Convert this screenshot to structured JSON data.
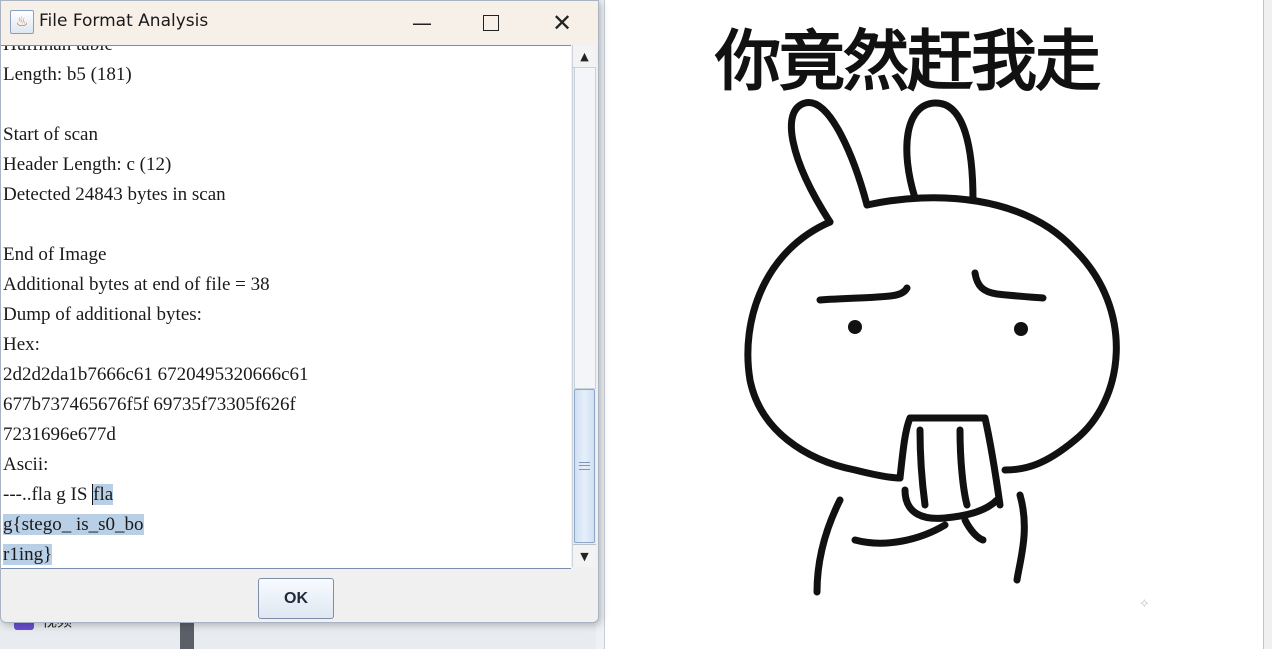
{
  "dialog": {
    "title": "File Format Analysis",
    "ok_label": "OK",
    "lines": [
      "Huffman table",
      "Length: b5 (181)",
      "",
      "Start of scan",
      "Header Length: c (12)",
      "Detected 24843 bytes in scan",
      "",
      "End of Image",
      "Additional bytes at end of file = 38",
      "Dump of additional bytes:",
      "Hex:",
      "2d2d2da1b7666c61 6720495320666c61",
      "677b737465676f5f 69735f73305f626f",
      "7231696e677d",
      "Ascii:"
    ],
    "ascii_line1_pre": "---..fla g IS ",
    "ascii_line1_sel": "fla",
    "ascii_line2_sel": "g{stego_ is_s0_bo",
    "ascii_line3_sel": "r1ing}"
  },
  "taskbar": {
    "item_label": "视频",
    "close_glyph": "✕"
  },
  "meme": {
    "caption": "你竟然赶我走",
    "watermark": "⟡"
  },
  "colors": {
    "selection": "#b8cfe6",
    "titlebar": "#f6f0e9",
    "dialog_bg": "#f0f0f0"
  }
}
